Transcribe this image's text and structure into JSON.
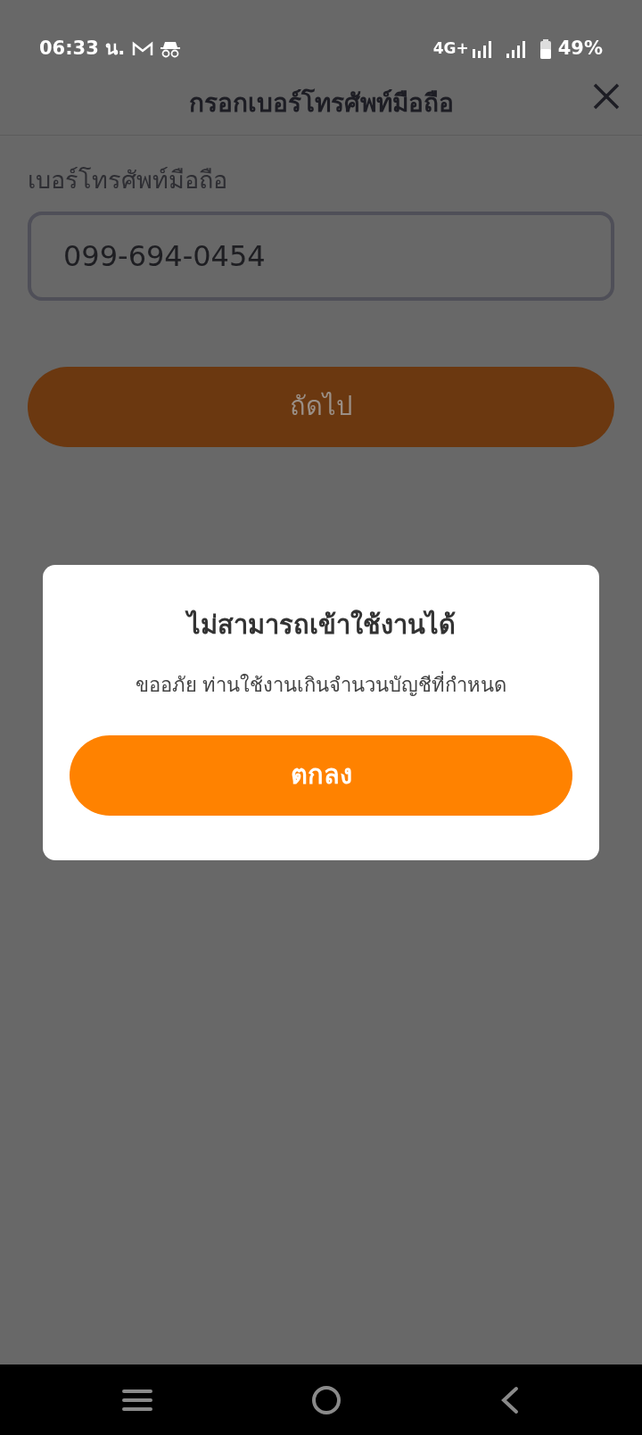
{
  "status_bar": {
    "time": "06:33 น.",
    "network": "4G+",
    "battery": "49%"
  },
  "header": {
    "title": "กรอกเบอร์โทรศัพท์มือถือ"
  },
  "form": {
    "label": "เบอร์โทรศัพท์มือถือ",
    "phone_value": "099-694-0454",
    "next_button": {
      "label": "ถัดไป",
      "disabled": true
    }
  },
  "dialog": {
    "title": "ไม่สามารถเข้าใช้งานได้",
    "message": "ขออภัย ท่านใช้งานเกินจำนวนบัญชีที่กำหนด",
    "ok_button": "ตกลง"
  }
}
